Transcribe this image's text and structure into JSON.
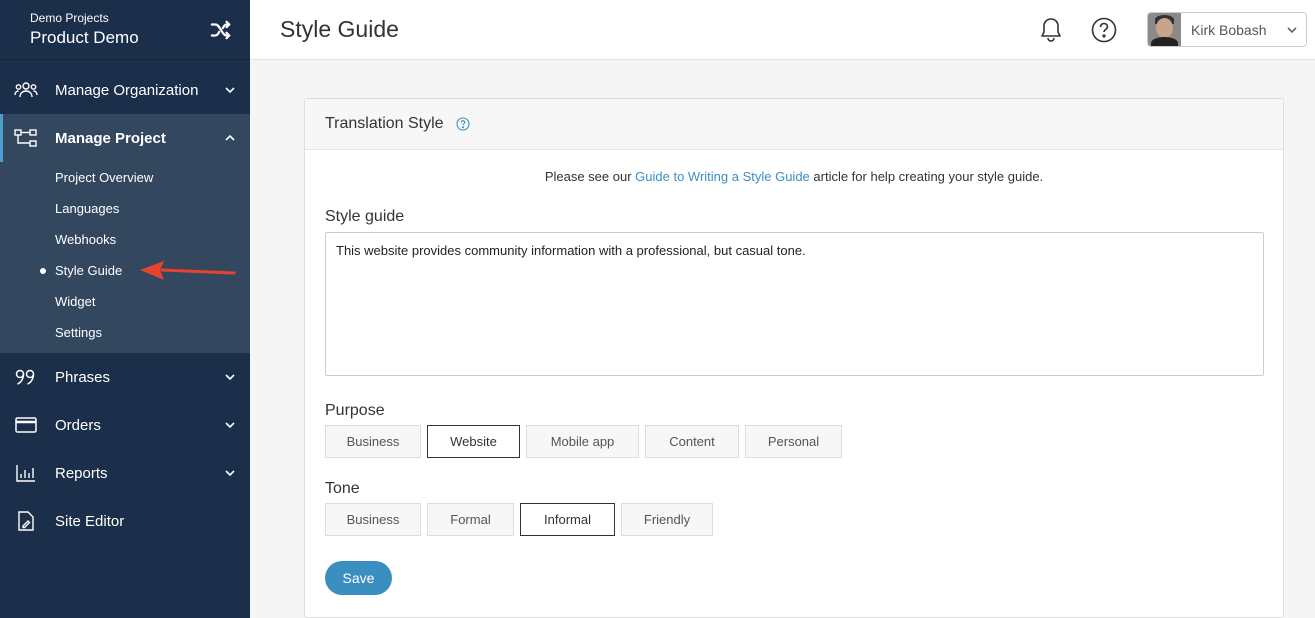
{
  "brand": {
    "subtitle": "Demo Projects",
    "title": "Product Demo"
  },
  "sidebar": {
    "items": [
      {
        "label": "Manage Organization",
        "icon": "people-icon"
      },
      {
        "label": "Manage Project",
        "icon": "tree-icon"
      },
      {
        "label": "Phrases",
        "icon": "quote-icon"
      },
      {
        "label": "Orders",
        "icon": "card-icon"
      },
      {
        "label": "Reports",
        "icon": "chart-icon"
      },
      {
        "label": "Site Editor",
        "icon": "file-edit-icon"
      }
    ],
    "submenu": [
      "Project Overview",
      "Languages",
      "Webhooks",
      "Style Guide",
      "Widget",
      "Settings"
    ]
  },
  "header": {
    "title": "Style Guide",
    "user_name": "Kirk Bobash"
  },
  "card": {
    "title": "Translation Style",
    "note_prefix": "Please see our ",
    "note_link": "Guide to Writing a Style Guide",
    "note_suffix": " article for help creating your style guide.",
    "style_label": "Style guide",
    "style_text": "This website provides community information with a professional, but casual tone.",
    "purpose_label": "Purpose",
    "purpose_options": [
      "Business",
      "Website",
      "Mobile app",
      "Content",
      "Personal"
    ],
    "purpose_selected": "Website",
    "tone_label": "Tone",
    "tone_options": [
      "Business",
      "Formal",
      "Informal",
      "Friendly"
    ],
    "tone_selected": "Informal",
    "save_label": "Save"
  },
  "colors": {
    "sidebar": "#1b2e4a",
    "submenu": "#33475f",
    "accent": "#3b8fc0",
    "arrow": "#e8432e"
  }
}
